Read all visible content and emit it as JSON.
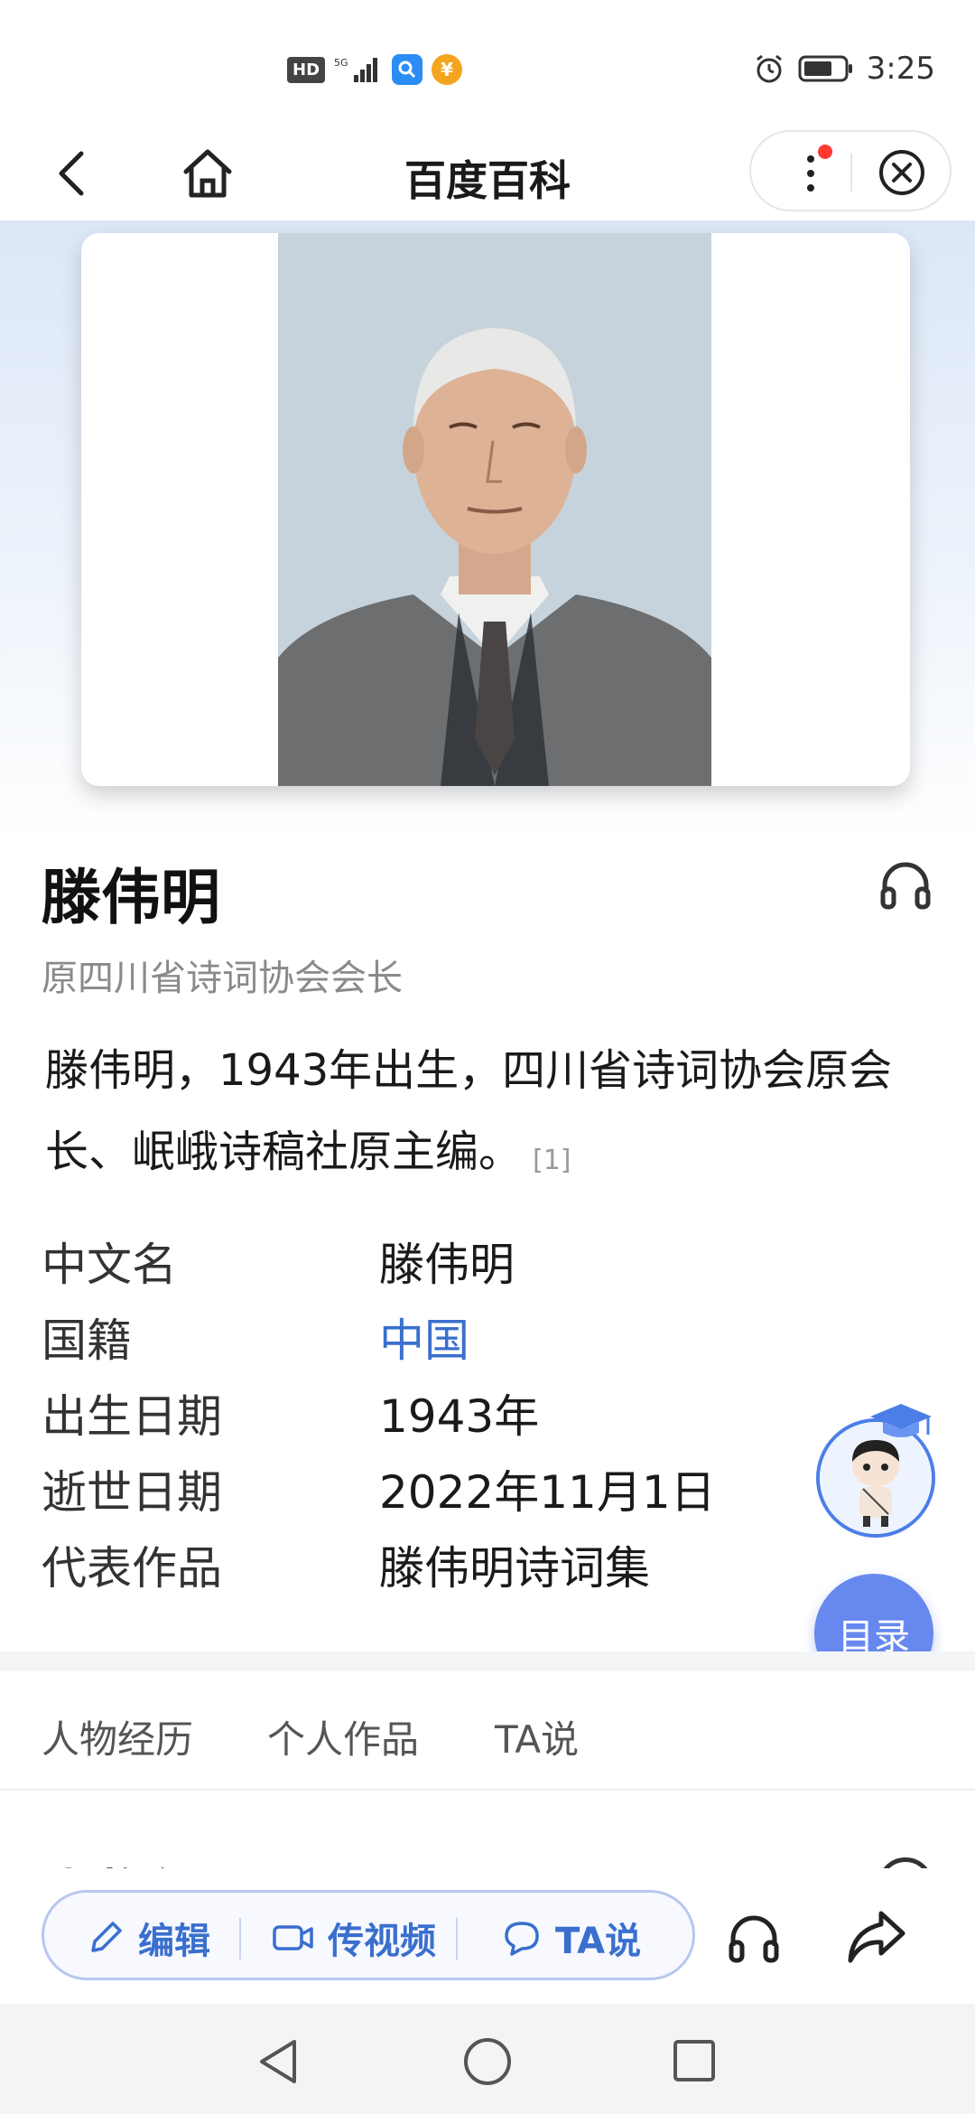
{
  "status_bar": {
    "hd": "HD",
    "network": "5G",
    "time": "3:25",
    "icons": [
      "hd-icon",
      "signal-icon",
      "search-app-icon",
      "yuan-app-icon",
      "alarm-icon",
      "battery-icon"
    ]
  },
  "nav": {
    "title": "百度百科"
  },
  "entry": {
    "name": "滕伟明",
    "subtitle": "原四川省诗词协会会长",
    "summary": "滕伟明，1943年出生，四川省诗词协会原会长、岷峨诗稿社原主编。",
    "ref": "[1]"
  },
  "info": [
    {
      "key": "中文名",
      "value": "滕伟明",
      "link": false
    },
    {
      "key": "国籍",
      "value": "中国",
      "link": true
    },
    {
      "key": "出生日期",
      "value": "1943年",
      "link": false
    },
    {
      "key": "逝世日期",
      "value": "2022年11月1日",
      "link": false
    },
    {
      "key": "代表作品",
      "value": "滕伟明诗词集",
      "link": false
    }
  ],
  "float": {
    "toc_label": "目录"
  },
  "tabs": [
    "人物经历",
    "个人作品",
    "TA说"
  ],
  "partial_heading": "人物经历",
  "toolbar": {
    "edit": "编辑",
    "video": "传视频",
    "ta": "TA说"
  },
  "colors": {
    "accent": "#3a6fce",
    "toc_bg": "#6788ee",
    "notification_dot": "#ff3b30"
  }
}
